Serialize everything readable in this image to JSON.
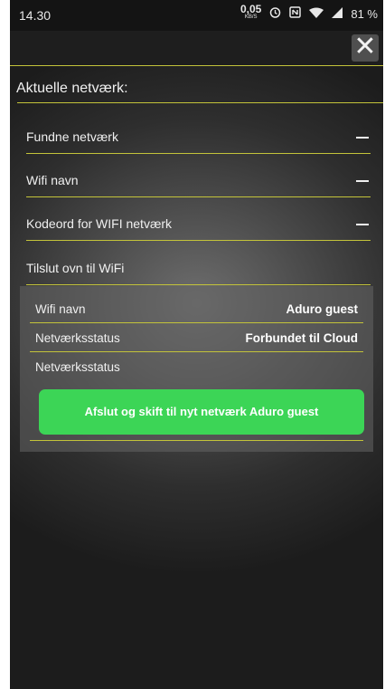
{
  "status_bar": {
    "time": "14.30",
    "net_speed_value": "0,05",
    "net_speed_unit": "KB/S",
    "battery": "81 %",
    "icons": [
      "alarm-icon",
      "nfc-icon",
      "wifi-icon",
      "signal-icon"
    ]
  },
  "header": {
    "close_label": "✕"
  },
  "title": "Aktuelle netværk:",
  "sections": [
    {
      "label": "Fundne netværk"
    },
    {
      "label": "Wifi navn"
    },
    {
      "label": "Kodeord for WIFI netværk"
    },
    {
      "label": "Tilslut ovn til WiFi"
    }
  ],
  "panel": {
    "rows": [
      {
        "label": "Wifi navn",
        "value": "Aduro guest"
      },
      {
        "label": "Netværksstatus",
        "value": "Forbundet til Cloud"
      },
      {
        "label": "Netværksstatus",
        "value": ""
      }
    ],
    "button_label": "Afslut og skift til nyt netværk Aduro guest"
  },
  "colors": {
    "accent_line": "#c3c33a",
    "button_green": "#3cd556",
    "background": "#2e2e2e"
  }
}
